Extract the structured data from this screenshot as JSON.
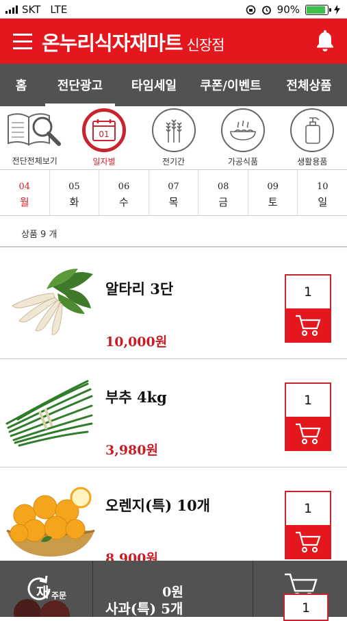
{
  "status_bar": {
    "carrier": "SKT",
    "network": "LTE",
    "battery": "90%"
  },
  "header": {
    "title": "온누리식자재마트",
    "branch": "신장점"
  },
  "nav": {
    "tabs": [
      {
        "label": "홈"
      },
      {
        "label": "전단광고"
      },
      {
        "label": "타임세일"
      },
      {
        "label": "쿠폰/이벤트"
      },
      {
        "label": "전체상품"
      }
    ],
    "active": "전단광고"
  },
  "categories": [
    {
      "label": "전단전체보기",
      "icon": "magnifier-book-icon"
    },
    {
      "label": "일자별",
      "icon": "calendar-icon",
      "calendar_text": "01"
    },
    {
      "label": "전기간",
      "icon": "wheat-icon"
    },
    {
      "label": "가공식품",
      "icon": "noodle-bowl-icon"
    },
    {
      "label": "생활용품",
      "icon": "pump-bottle-icon"
    }
  ],
  "days": [
    {
      "num": "04",
      "dow": "월"
    },
    {
      "num": "05",
      "dow": "화"
    },
    {
      "num": "06",
      "dow": "수"
    },
    {
      "num": "07",
      "dow": "목"
    },
    {
      "num": "08",
      "dow": "금"
    },
    {
      "num": "09",
      "dow": "토"
    },
    {
      "num": "10",
      "dow": "일"
    }
  ],
  "product_count": "상품 9 개",
  "products": [
    {
      "name": "알타리 3단",
      "price": "10,000원",
      "qty": "1"
    },
    {
      "name": "부추 4kg",
      "price": "3,980원",
      "qty": "1"
    },
    {
      "name": "오렌지(특) 10개",
      "price": "8,900원",
      "qty": "1"
    }
  ],
  "bottom_bar": {
    "reorder_main": "재",
    "reorder_sub": "주문",
    "total": "0원",
    "peek_name": "사과(특) 5개",
    "peek_qty": "1"
  },
  "colors": {
    "brand_red": "#e4171f",
    "nav_gray": "#525252",
    "price_red": "#c81d24"
  }
}
